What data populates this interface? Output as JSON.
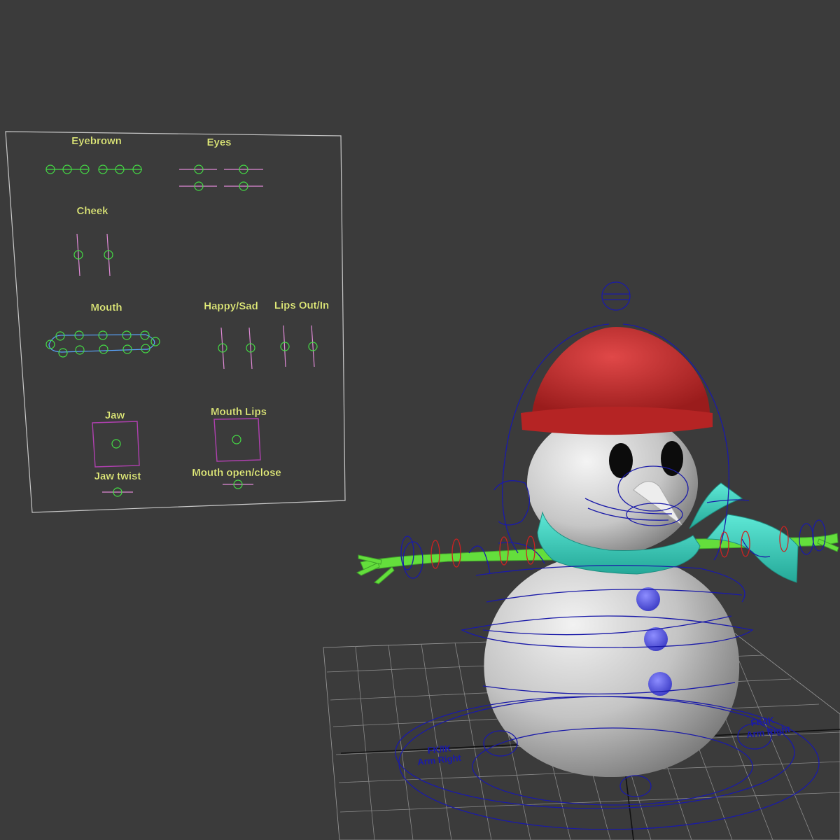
{
  "viewport": {
    "background": "#3b3b3b",
    "panel_label_color": "#e6f07a",
    "ctrl_green": "#44dd44",
    "ctrl_pink": "#e08ad6",
    "ctrl_blue": "#3a5cff",
    "rig_blue": "#1a1aa8"
  },
  "face_panel": {
    "labels": {
      "eyebrown": "Eyebrown",
      "eyes": "Eyes",
      "cheek": "Cheek",
      "mouth": "Mouth",
      "happy_sad": "Happy/Sad",
      "lips_out_in": "Lips Out/In",
      "jaw": "Jaw",
      "mouth_lips": "Mouth Lips",
      "jaw_twist": "Jaw twist",
      "mouth_open_close": "Mouth open/close"
    }
  },
  "snowman": {
    "colors": {
      "body": "#d2d2d2",
      "hat": "#c22e2e",
      "scarf": "#36d0bd",
      "arms": "#64de3c",
      "buttons": "#5a5ae0",
      "eyes": "#0c0c0c",
      "nose": "#eeeeee"
    },
    "ground_labels": {
      "left_line1": "FK/IK",
      "left_line2": "Arm Right",
      "right_line1": "FK/IK",
      "right_line2": "Arm Right"
    }
  }
}
